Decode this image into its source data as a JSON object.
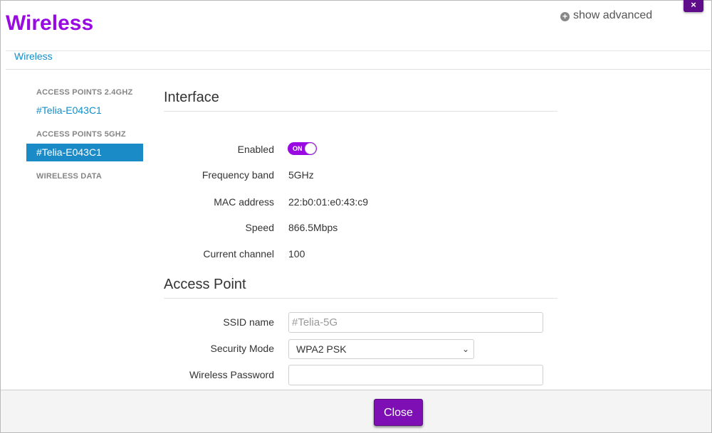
{
  "header": {
    "title": "Wireless",
    "show_advanced": "show advanced",
    "close_x": "×"
  },
  "breadcrumb": "Wireless",
  "sidebar": {
    "section_24": "ACCESS POINTS 2.4GHZ",
    "item_24": "#Telia-E043C1",
    "section_5": "ACCESS POINTS 5GHZ",
    "item_5": "#Telia-E043C1",
    "section_data": "WIRELESS DATA"
  },
  "interface": {
    "title": "Interface",
    "enabled_label": "Enabled",
    "toggle_text": "ON",
    "frequency_label": "Frequency band",
    "frequency_value": "5GHz",
    "mac_label": "MAC address",
    "mac_value": "22:b0:01:e0:43:c9",
    "speed_label": "Speed",
    "speed_value": "866.5Mbps",
    "channel_label": "Current channel",
    "channel_value": "100"
  },
  "access_point": {
    "title": "Access Point",
    "ssid_label": "SSID name",
    "ssid_value": "#Telia-5G",
    "security_label": "Security Mode",
    "security_value": "WPA2 PSK",
    "password_label": "Wireless Password",
    "password_value": ""
  },
  "footer": {
    "close_label": "Close"
  },
  "colors": {
    "brand": "#990ae3",
    "link": "#0f8fcb",
    "active": "#1b8bc8"
  }
}
